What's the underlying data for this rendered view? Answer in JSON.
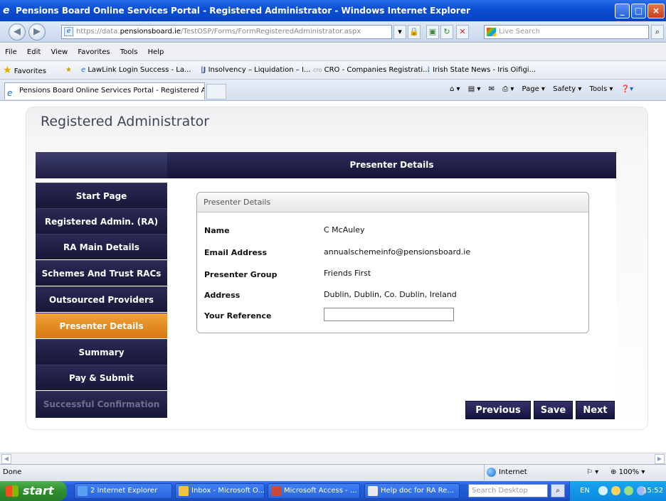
{
  "browser": {
    "title": "Pensions Board Online Services Portal - Registered Administrator - Windows Internet Explorer",
    "address_secure": "https://data.",
    "address_domain": "pensionsboard.ie",
    "address_path": "/TestOSP/Forms/FormRegisteredAdministrator.aspx",
    "search_placeholder": "Live Search",
    "menu": [
      "File",
      "Edit",
      "View",
      "Favorites",
      "Tools",
      "Help"
    ],
    "favorites_label": "Favorites",
    "favorites": [
      "LawLink Login Success - La...",
      "Insolvency – Liquidation – I...",
      "CRO - Companies Registrati...",
      "Irish State News - Iris Oifigi..."
    ],
    "tab_label": "Pensions Board Online Services Portal - Registered Ad...",
    "command_bar": [
      "Page ▾",
      "Safety ▾",
      "Tools ▾"
    ],
    "status_text": "Done",
    "zone": "Internet",
    "zoom": "100%"
  },
  "page": {
    "title": "Registered Administrator",
    "section_header": "Presenter Details",
    "nav": [
      {
        "label": "Start Page",
        "state": "normal"
      },
      {
        "label": "Registered Admin. (RA)",
        "state": "normal"
      },
      {
        "label": "RA Main Details",
        "state": "normal"
      },
      {
        "label": "Schemes And Trust RACs",
        "state": "normal"
      },
      {
        "label": "Outsourced Providers",
        "state": "normal"
      },
      {
        "label": "Presenter Details",
        "state": "active"
      },
      {
        "label": "Summary",
        "state": "normal"
      },
      {
        "label": "Pay & Submit",
        "state": "normal"
      },
      {
        "label": "Successful Confirmation",
        "state": "disabled"
      }
    ],
    "fieldset_title": "Presenter Details",
    "fields": [
      {
        "label": "Name",
        "value": "C McAuley"
      },
      {
        "label": "Email Address",
        "value": "annualschemeinfo@pensionsboard.ie"
      },
      {
        "label": "Presenter Group",
        "value": "Friends First"
      },
      {
        "label": "Address",
        "value": "Dublin, Dublin, Co. Dublin, Ireland"
      }
    ],
    "reference_label": "Your Reference",
    "reference_value": "",
    "buttons": {
      "previous": "Previous",
      "save": "Save",
      "next": "Next"
    }
  },
  "taskbar": {
    "start": "start",
    "tasks": [
      "2 Internet Explorer",
      "Inbox - Microsoft O...",
      "Microsoft Access - ...",
      "Help doc for RA Re..."
    ],
    "search_placeholder": "Search Desktop",
    "language": "EN",
    "clock": "15:52"
  },
  "colors": {
    "nav_bg": "#1e1e45",
    "nav_active": "#e58b20",
    "titlebar": "#0a4fd6"
  }
}
